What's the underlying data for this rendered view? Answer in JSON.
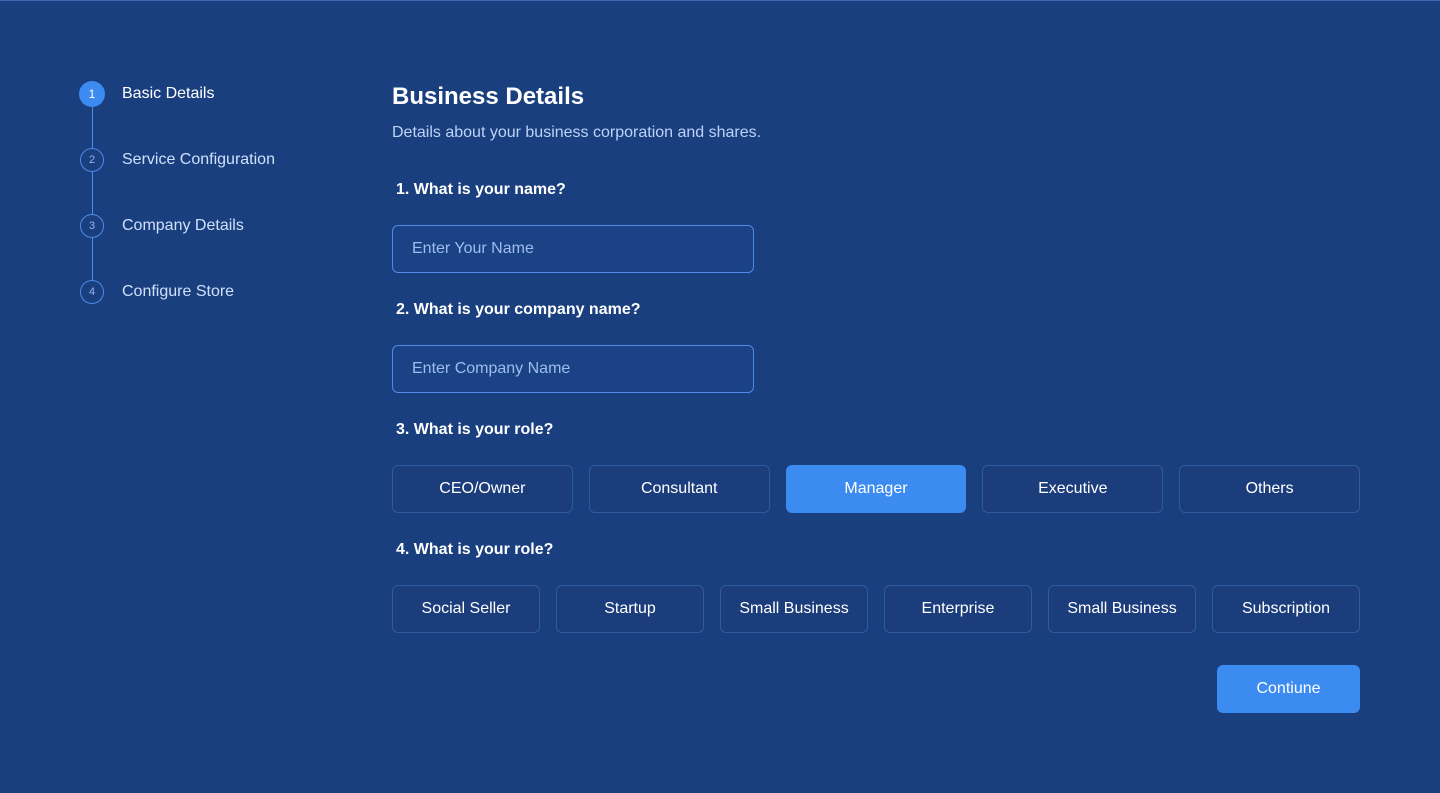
{
  "stepper": {
    "steps": [
      {
        "number": "1",
        "label": "Basic Details",
        "active": true
      },
      {
        "number": "2",
        "label": "Service Configuration",
        "active": false
      },
      {
        "number": "3",
        "label": "Company Details",
        "active": false
      },
      {
        "number": "4",
        "label": "Configure Store",
        "active": false
      }
    ]
  },
  "form": {
    "title": "Business Details",
    "subtitle": "Details about your business corporation and shares.",
    "q1": {
      "label": "1. What is your name?",
      "placeholder": "Enter Your Name",
      "value": ""
    },
    "q2": {
      "label": "2. What is your company name?",
      "placeholder": "Enter Company Name",
      "value": ""
    },
    "q3": {
      "label": "3. What is your role?",
      "options": [
        "CEO/Owner",
        "Consultant",
        "Manager",
        "Executive",
        "Others"
      ],
      "selected": "Manager"
    },
    "q4": {
      "label": "4. What is your role?",
      "options": [
        "Social Seller",
        "Startup",
        "Small Business",
        "Enterprise",
        "Small Business",
        "Subscription"
      ],
      "selected": ""
    },
    "continue_label": "Contiune"
  },
  "colors": {
    "background": "#1a3f7f",
    "accent": "#3b8bf0",
    "border": "#4f8ae6",
    "muted_text": "#bcd3f7"
  }
}
